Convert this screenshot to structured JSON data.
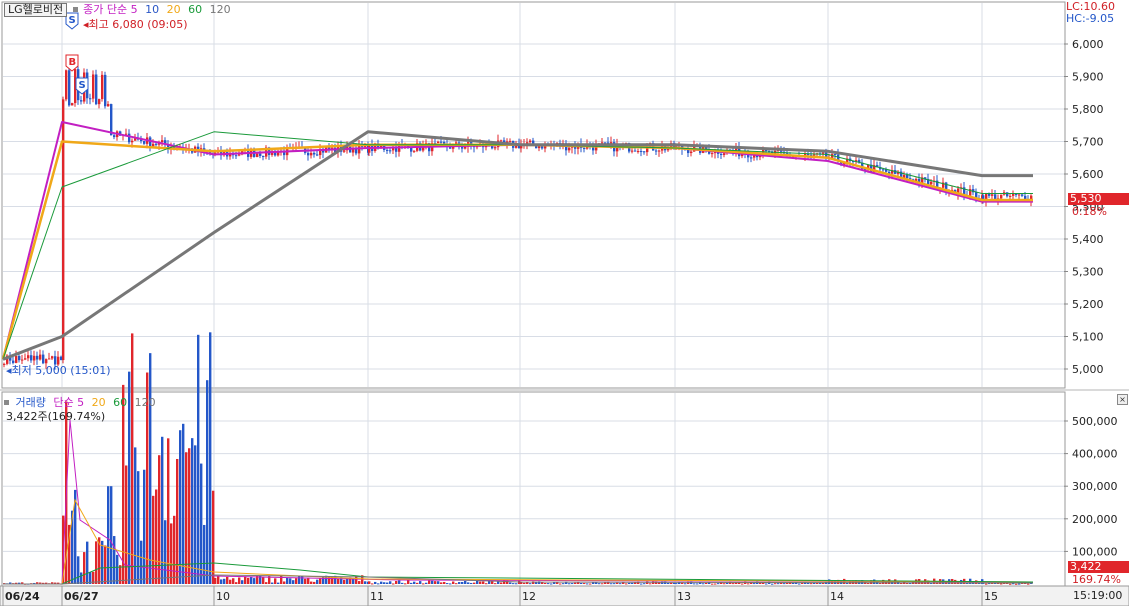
{
  "header": {
    "stock_name": "LG헬로비전",
    "price_legend": {
      "label": "종가",
      "ma_type": "단순",
      "periods": [
        "5",
        "10",
        "20",
        "60",
        "120"
      ]
    },
    "lc": "LC:10.60",
    "hc": "HC:-9.05"
  },
  "price_panel": {
    "high_marker": "최고 6,080 (09:05)",
    "low_marker": "최저 5,000 (15:01)",
    "current_price": "5,530",
    "change_percent": "0.18%",
    "y_ticks": [
      "6,000",
      "5,900",
      "5,800",
      "5,700",
      "5,600",
      "5,500",
      "5,400",
      "5,300",
      "5,200",
      "5,100",
      "5,000"
    ],
    "signal_marks": [
      "S",
      "B",
      "S"
    ]
  },
  "volume_panel": {
    "label": "거래량",
    "ma_type": "단순",
    "periods": [
      "5",
      "20",
      "60",
      "120"
    ],
    "info": "3,422주(169.74%)",
    "current_volume": "3,422",
    "volume_percent": "169.74%",
    "y_ticks": [
      "500,000",
      "400,000",
      "300,000",
      "200,000",
      "100,000"
    ]
  },
  "x_axis": {
    "labels": [
      "06/24",
      "06/27",
      "10",
      "11",
      "12",
      "13",
      "14",
      "15"
    ],
    "time": "15:19:00"
  },
  "colors": {
    "up": "#e0262b",
    "down": "#2457c9",
    "ma5": "#c21fc2",
    "ma10": "#2a56c6",
    "ma20": "#f0a818",
    "ma60": "#1a9a3a",
    "ma120": "#777777",
    "current_badge": "#e0262b"
  },
  "chart_data": [
    {
      "type": "line",
      "title": "LG헬로비전",
      "x": [
        "06/24",
        "06/27",
        "10",
        "11",
        "12",
        "13",
        "14",
        "15"
      ],
      "ylim": [
        4950,
        6080
      ],
      "series": [
        {
          "name": "종가",
          "values": [
            5030,
            5750,
            5660,
            5680,
            5690,
            5680,
            5650,
            5530
          ]
        },
        {
          "name": "5",
          "values": [
            5030,
            5760,
            5660,
            5680,
            5690,
            5680,
            5640,
            5515
          ]
        },
        {
          "name": "20",
          "values": [
            5030,
            5700,
            5670,
            5690,
            5690,
            5680,
            5650,
            5520
          ]
        },
        {
          "name": "60",
          "values": [
            5030,
            5560,
            5730,
            5690,
            5690,
            5680,
            5660,
            5540
          ]
        },
        {
          "name": "120",
          "values": [
            5030,
            5100,
            5420,
            5730,
            5690,
            5690,
            5670,
            5595
          ]
        }
      ]
    },
    {
      "type": "bar",
      "title": "거래량",
      "x": [
        "06/24",
        "06/27",
        "10",
        "11",
        "12",
        "13",
        "14",
        "15"
      ],
      "ylim": [
        0,
        560000
      ],
      "series": [
        {
          "name": "거래량",
          "values": [
            4000,
            560000,
            20000,
            8000,
            6000,
            5000,
            12000,
            3422
          ]
        }
      ]
    }
  ]
}
